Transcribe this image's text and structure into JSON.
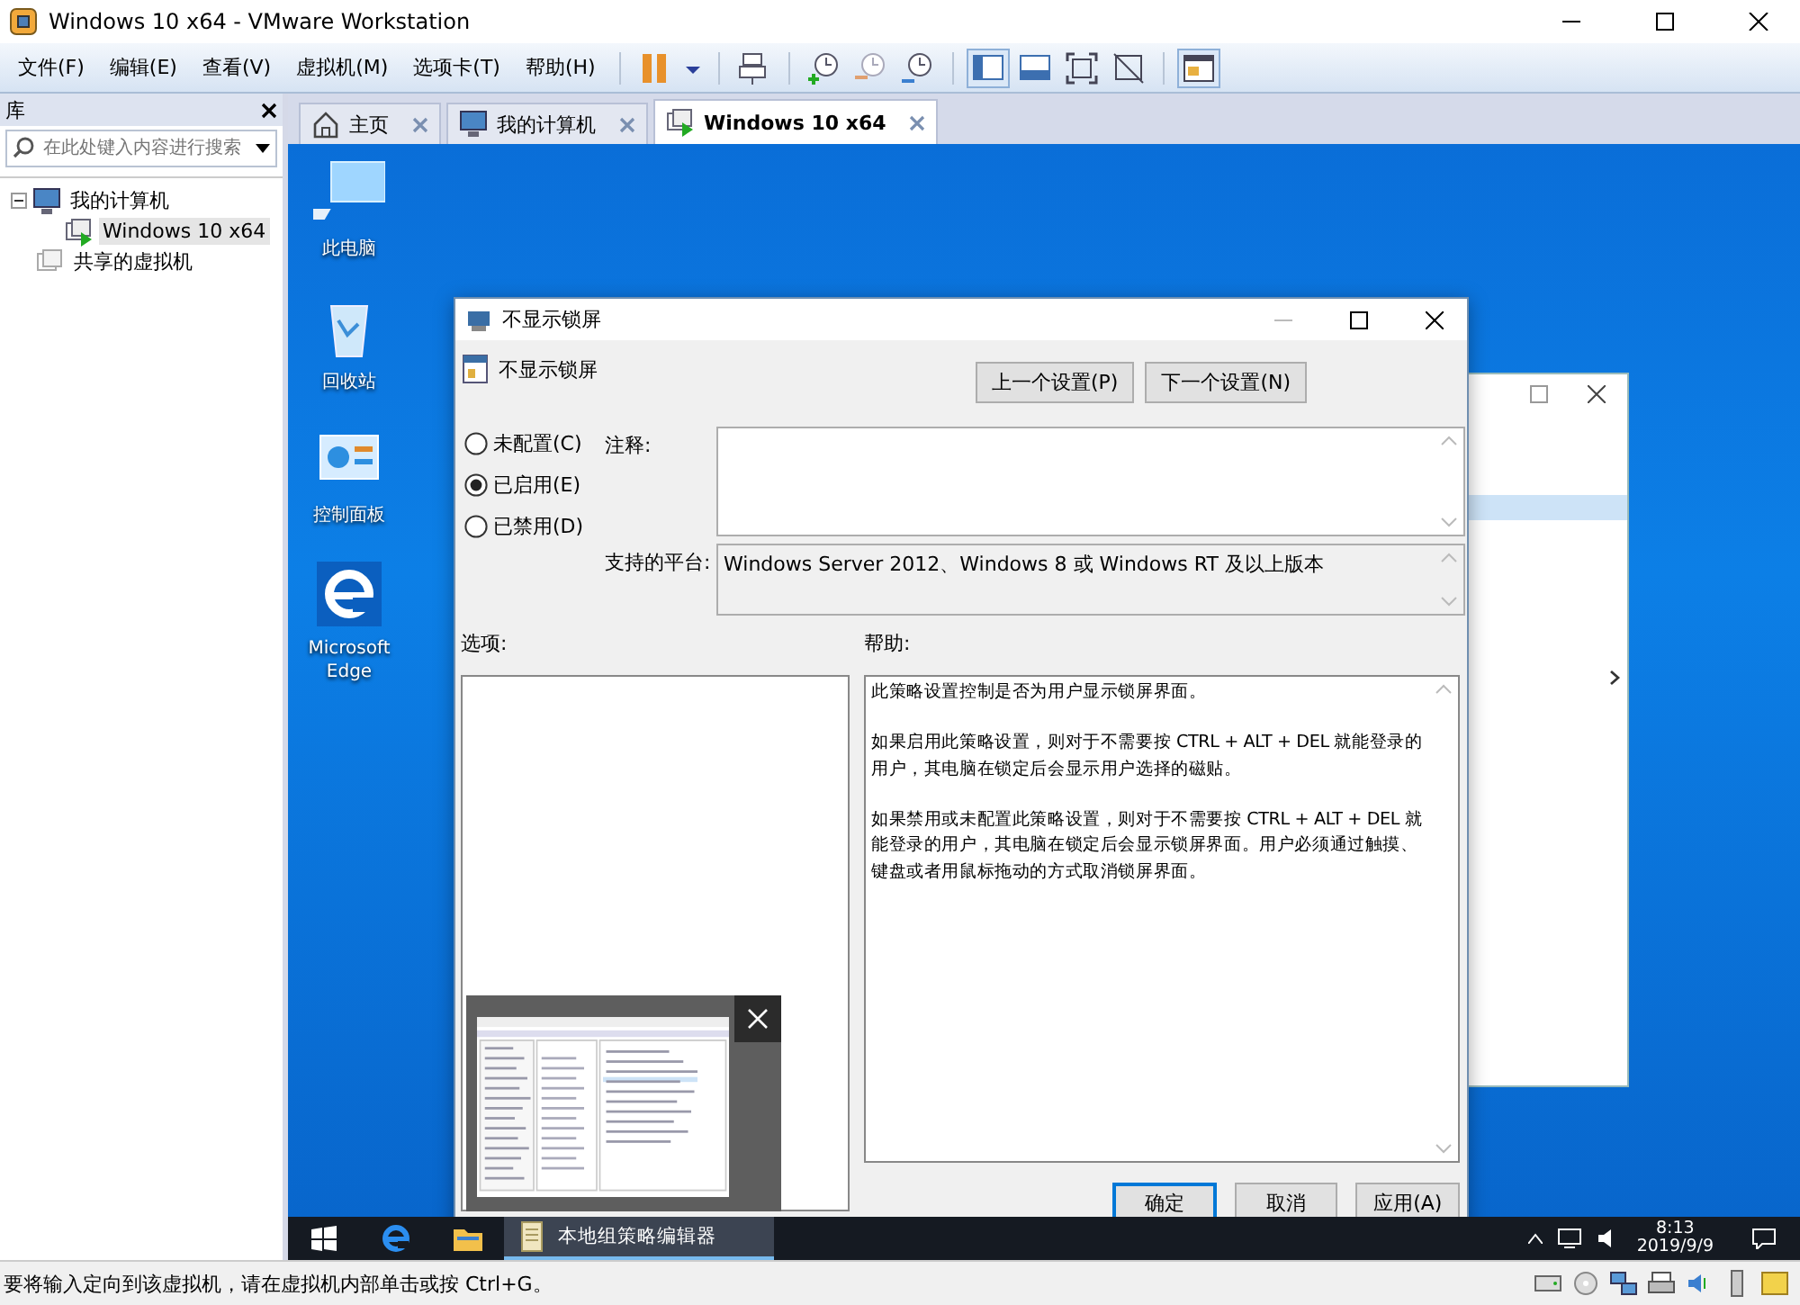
{
  "window": {
    "title": "Windows 10 x64 - VMware Workstation"
  },
  "menu": [
    "文件(F)",
    "编辑(E)",
    "查看(V)",
    "虚拟机(M)",
    "选项卡(T)",
    "帮助(H)"
  ],
  "library": {
    "title": "库",
    "search": {
      "placeholder": "在此处键入内容进行搜索"
    },
    "tree": [
      {
        "label": "我的计算机",
        "kind": "computer",
        "expanded": true,
        "selected": false,
        "children": [
          {
            "label": "Windows 10 x64",
            "kind": "vm",
            "selected": true
          }
        ]
      },
      {
        "label": "共享的虚拟机",
        "kind": "shared",
        "selected": false
      }
    ]
  },
  "tabs": [
    {
      "label": "主页",
      "kind": "home",
      "selected": false
    },
    {
      "label": "我的计算机",
      "kind": "computer",
      "selected": false
    },
    {
      "label": "Windows 10 x64",
      "kind": "vm",
      "selected": true
    }
  ],
  "desktop_icons": [
    {
      "label": "此电脑",
      "kind": "pc"
    },
    {
      "label": "回收站",
      "kind": "bin"
    },
    {
      "label": "控制面板",
      "kind": "panel"
    },
    {
      "label": "Microsoft Edge",
      "kind": "edge"
    }
  ],
  "dialog": {
    "title": "不显示锁屏",
    "heading": "不显示锁屏",
    "nav_buttons": [
      "上一个设置(P)",
      "下一个设置(N)"
    ],
    "options": [
      {
        "label": "未配置(C)",
        "selected": false
      },
      {
        "label": "已启用(E)",
        "selected": true
      },
      {
        "label": "已禁用(D)",
        "selected": false
      }
    ],
    "comment_label": "注释:",
    "platform_label": "支持的平台:",
    "platform": "Windows Server 2012、Windows 8 或 Windows RT 及以上版本",
    "options_label": "选项:",
    "help_label": "帮助:",
    "help": [
      "此策略设置控制是否为用户显示锁屏界面。",
      "如果启用此策略设置，则对于不需要按 CTRL + ALT + DEL  就能登录的用户，其电脑在锁定后会显示用户选择的磁贴。",
      "如果禁用或未配置此策略设置，则对于不需要按 CTRL + ALT + DEL 就能登录的用户，其电脑在锁定后会显示锁屏界面。用户必须通过触摸、键盘或者用鼠标拖动的方式取消锁屏界面。"
    ],
    "buttons": [
      "确定",
      "取消",
      "应用(A)"
    ]
  },
  "taskbar": {
    "apps": [
      {
        "label": "本地组策略编辑器",
        "selected": true
      }
    ],
    "time": "8:13",
    "date": "2019/9/9"
  },
  "status_bar": "要将输入定向到该虚拟机，请在虚拟机内部单击或按 Ctrl+G。"
}
